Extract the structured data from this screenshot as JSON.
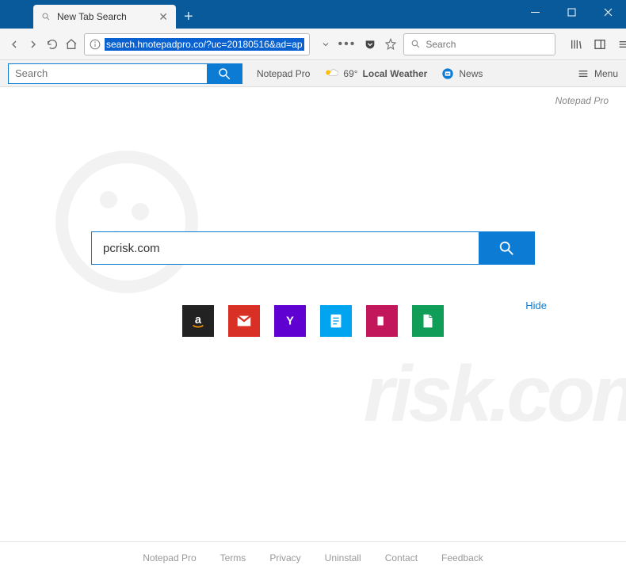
{
  "window": {
    "tab_title": "New Tab Search",
    "address_url": "search.hnotepadpro.co/?uc=20180516&ad=ap",
    "browser_search_placeholder": "Search"
  },
  "ext_toolbar": {
    "search_placeholder": "Search",
    "notepad_label": "Notepad Pro",
    "weather_temp": "69°",
    "weather_label": "Local Weather",
    "news_label": "News",
    "menu_label": "Menu"
  },
  "page": {
    "brand": "Notepad Pro",
    "search_value": "pcrisk.com",
    "hide_label": "Hide",
    "tiles": [
      {
        "name": "amazon",
        "bg": "#222222"
      },
      {
        "name": "gmail",
        "bg": "#d93025"
      },
      {
        "name": "yahoo",
        "bg": "#5f01d1"
      },
      {
        "name": "notes",
        "bg": "#00a4ef"
      },
      {
        "name": "share",
        "bg": "#c2185b"
      },
      {
        "name": "docs",
        "bg": "#0f9d58"
      }
    ]
  },
  "footer": {
    "links": [
      "Notepad Pro",
      "Terms",
      "Privacy",
      "Uninstall",
      "Contact",
      "Feedback"
    ]
  }
}
